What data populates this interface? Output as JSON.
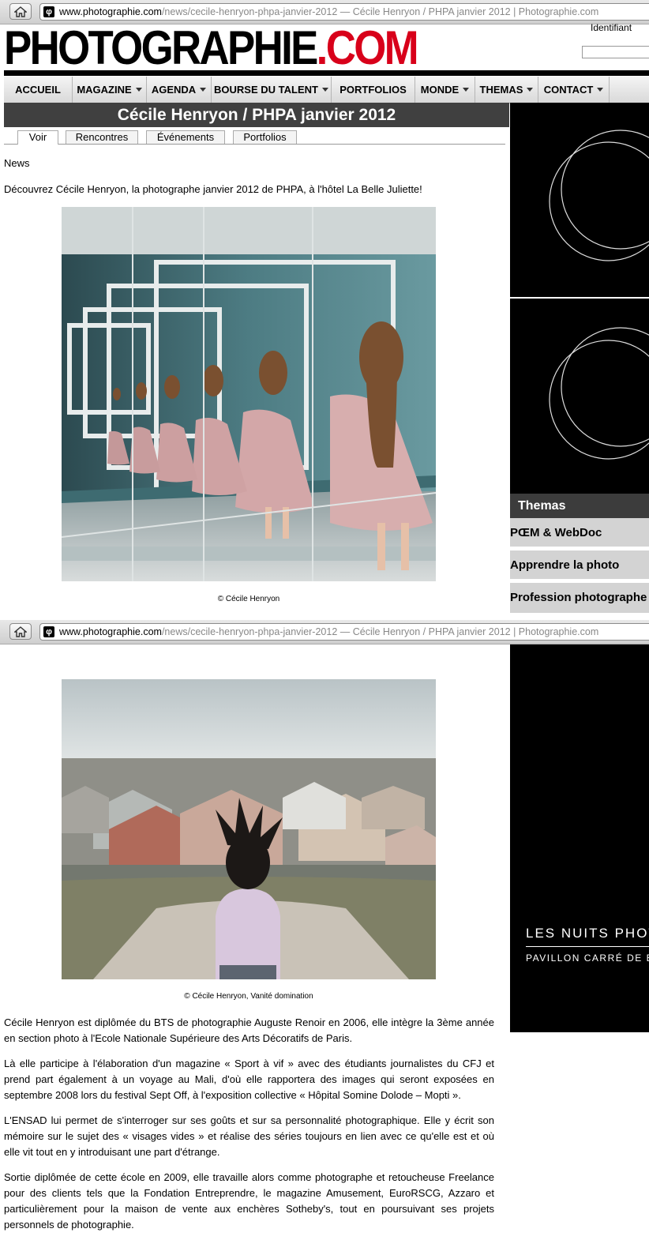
{
  "browser": {
    "url_domain": "www.photographie.com",
    "url_rest": "/news/cecile-henryon-phpa-janvier-2012 — Cécile Henryon / PHPA janvier 2012 | Photographie.com"
  },
  "header": {
    "logo_main": "PHOTOGRAPHIE",
    "logo_suffix": ".COM",
    "ident_label": "Identifiant"
  },
  "nav": {
    "items": [
      {
        "label": "ACCUEIL"
      },
      {
        "label": "MAGAZINE"
      },
      {
        "label": "AGENDA"
      },
      {
        "label": "BOURSE DU TALENT"
      },
      {
        "label": "PORTFOLIOS"
      },
      {
        "label": "MONDE"
      },
      {
        "label": "THEMAS"
      },
      {
        "label": "CONTACT"
      }
    ]
  },
  "article": {
    "title": "Cécile Henryon / PHPA janvier 2012",
    "tabs": [
      "Voir",
      "Rencontres",
      "Événements",
      "Portfolios"
    ],
    "category": "News",
    "intro": "Découvrez Cécile Henryon, la photographe janvier 2012 de PHPA, à l'hôtel La Belle Juliette!",
    "caption1": "© Cécile Henryon",
    "caption2": "© Cécile Henryon, Vanité domination",
    "paragraphs": [
      "Cécile Henryon est diplômée du  BTS de photographie Auguste Renoir en 2006, elle intègre la 3ème année en section photo à l'Ecole Nationale Supérieure des Arts Décoratifs de Paris.",
      "Là elle participe à l'élaboration d'un magazine « Sport à vif » avec des étudiants journalistes du CFJ et prend part également à un voyage au Mali, d'où elle rapportera des images qui seront exposées en septembre 2008 lors du festival Sept Off, à l'exposition collective « Hôpital Somine Dolode – Mopti ».",
      "L'ENSAD lui permet de s'interroger sur ses goûts et sur sa personnalité photographique. Elle y écrit son mémoire sur le sujet des « visages vides » et réalise des séries toujours en lien avec ce qu'elle est et où elle vit tout en y introduisant une part d'étrange.",
      "Sortie diplômée de cette école en 2009, elle travaille alors comme photographe et retoucheuse Freelance pour des clients tels que la Fondation Entreprendre, le magazine Amusement, EuroRSCG, Azzaro et particulièrement pour la maison de vente aux enchères Sotheby's, tout en poursuivant ses projets personnels de photographie."
    ]
  },
  "sidebar": {
    "themas_title": "Themas",
    "themas_items": [
      "PŒM & WebDoc",
      "Apprendre la photo",
      "Profession photographe"
    ],
    "ad_line1": "LES NUITS PHOTO",
    "ad_line2": "PAVILLON CARRÉ DE B"
  }
}
